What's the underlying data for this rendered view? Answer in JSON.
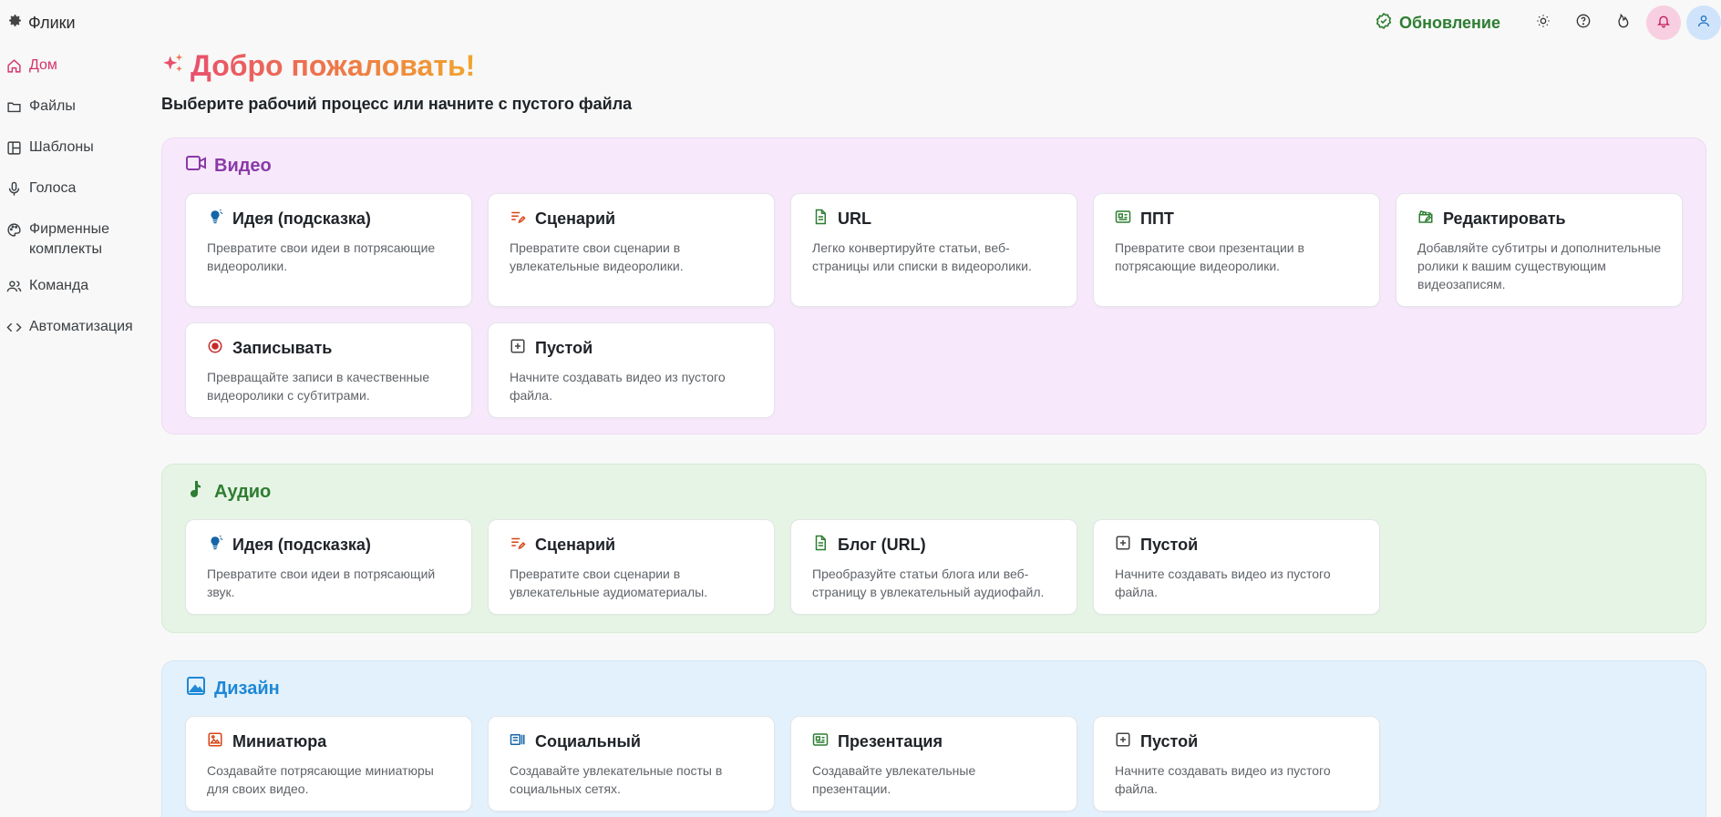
{
  "app": {
    "name": "Флики"
  },
  "topbar": {
    "update_label": "Обновление"
  },
  "sidebar": {
    "items": [
      {
        "label": "Дом",
        "icon": "home-icon"
      },
      {
        "label": "Файлы",
        "icon": "folder-icon"
      },
      {
        "label": "Шаблоны",
        "icon": "layout-icon"
      },
      {
        "label": "Голоса",
        "icon": "mic-icon"
      },
      {
        "label": "Фирменные комплекты",
        "icon": "palette-icon"
      },
      {
        "label": "Команда",
        "icon": "users-icon"
      },
      {
        "label": "Автоматизация",
        "icon": "code-icon"
      }
    ]
  },
  "main": {
    "welcome": "Добро пожаловать!",
    "subtitle": "Выберите рабочий процесс или начните с пустого файла",
    "sections": {
      "video": {
        "title": "Видео",
        "cards": [
          {
            "title": "Идея (подсказка)",
            "desc": "Превратите свои идеи в потрясающие видеоролики."
          },
          {
            "title": "Сценарий",
            "desc": "Превратите свои сценарии в увлекательные видеоролики."
          },
          {
            "title": "URL",
            "desc": "Легко конвертируйте статьи, веб-страницы или списки в видеоролики."
          },
          {
            "title": "ППТ",
            "desc": "Превратите свои презентации в потрясающие видеоролики."
          },
          {
            "title": "Редактировать",
            "desc": "Добавляйте субтитры и дополнительные ролики к вашим существующим видеозаписям."
          },
          {
            "title": "Записывать",
            "desc": "Превращайте записи в качественные видеоролики с субтитрами."
          },
          {
            "title": "Пустой",
            "desc": "Начните создавать видео из пустого файла."
          }
        ]
      },
      "audio": {
        "title": "Аудио",
        "cards": [
          {
            "title": "Идея (подсказка)",
            "desc": "Превратите свои идеи в потрясающий звук."
          },
          {
            "title": "Сценарий",
            "desc": "Превратите свои сценарии в увлекательные аудиоматериалы."
          },
          {
            "title": "Блог (URL)",
            "desc": "Преобразуйте статьи блога или веб-страницу в увлекательный аудиофайл."
          },
          {
            "title": "Пустой",
            "desc": "Начните создавать видео из пустого файла."
          }
        ]
      },
      "design": {
        "title": "Дизайн",
        "cards": [
          {
            "title": "Миниатюра",
            "desc": "Создавайте потрясающие миниатюры для своих видео."
          },
          {
            "title": "Социальный",
            "desc": "Создавайте увлекательные посты в социальных сетях."
          },
          {
            "title": "Презентация",
            "desc": "Создавайте увлекательные презентации."
          },
          {
            "title": "Пустой",
            "desc": "Начните создавать видео из пустого файла."
          }
        ]
      }
    }
  },
  "colors": {
    "accent_pink": "#d6336c",
    "video": "#8a3aa8",
    "audio": "#2e7d32",
    "design": "#1e88d6",
    "update": "#2e7d32"
  }
}
